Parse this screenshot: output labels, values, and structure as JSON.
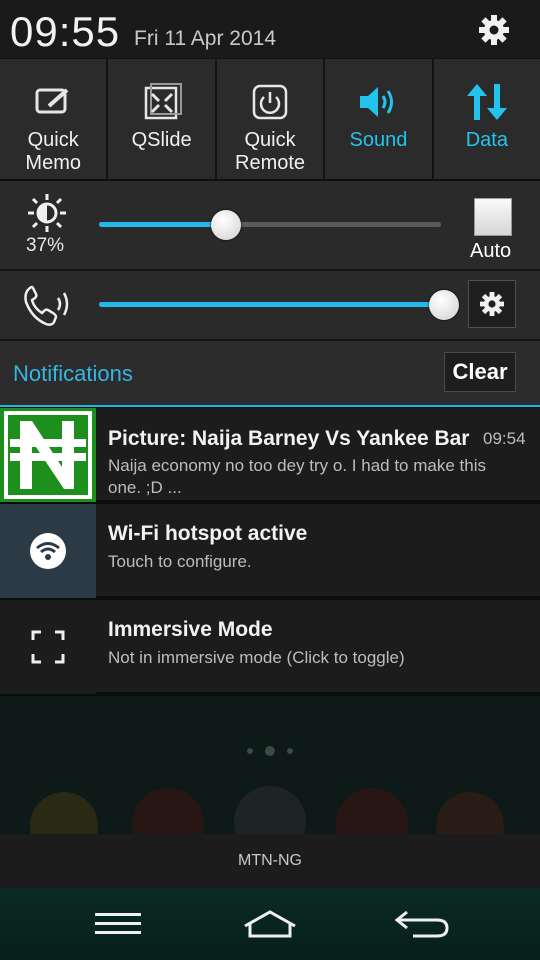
{
  "status": {
    "time": "09:55",
    "date": "Fri 11 Apr 2014"
  },
  "quick_settings": [
    {
      "label": "Quick\nMemo",
      "icon": "quickmemo-icon",
      "active": false
    },
    {
      "label": "QSlide",
      "icon": "qslide-icon",
      "active": false
    },
    {
      "label": "Quick\nRemote",
      "icon": "quickremote-icon",
      "active": false
    },
    {
      "label": "Sound",
      "icon": "speaker-icon",
      "active": true
    },
    {
      "label": "Data",
      "icon": "data-arrows-icon",
      "active": true
    }
  ],
  "brightness": {
    "percent_label": "37%",
    "level": 0.37,
    "auto_label": "Auto"
  },
  "volume": {
    "level": 0.98
  },
  "notifications_header": {
    "title": "Notifications",
    "clear_label": "Clear"
  },
  "notifications": [
    {
      "title": "Picture: Naija Barney Vs Yankee Bar",
      "text": "Naija economy no too dey try o. I had to make this one.  ;D ...",
      "time": "09:54",
      "icon": "naira-icon"
    },
    {
      "title": "Wi-Fi hotspot active",
      "text": "Touch to configure.",
      "icon": "wifi-icon"
    },
    {
      "title": "Immersive Mode",
      "text": "Not in immersive mode (Click to toggle)",
      "icon": "fullscreen-icon"
    }
  ],
  "carrier": "MTN-NG",
  "colors": {
    "accent": "#33b5e5",
    "active_toggle": "#22c4ee"
  }
}
